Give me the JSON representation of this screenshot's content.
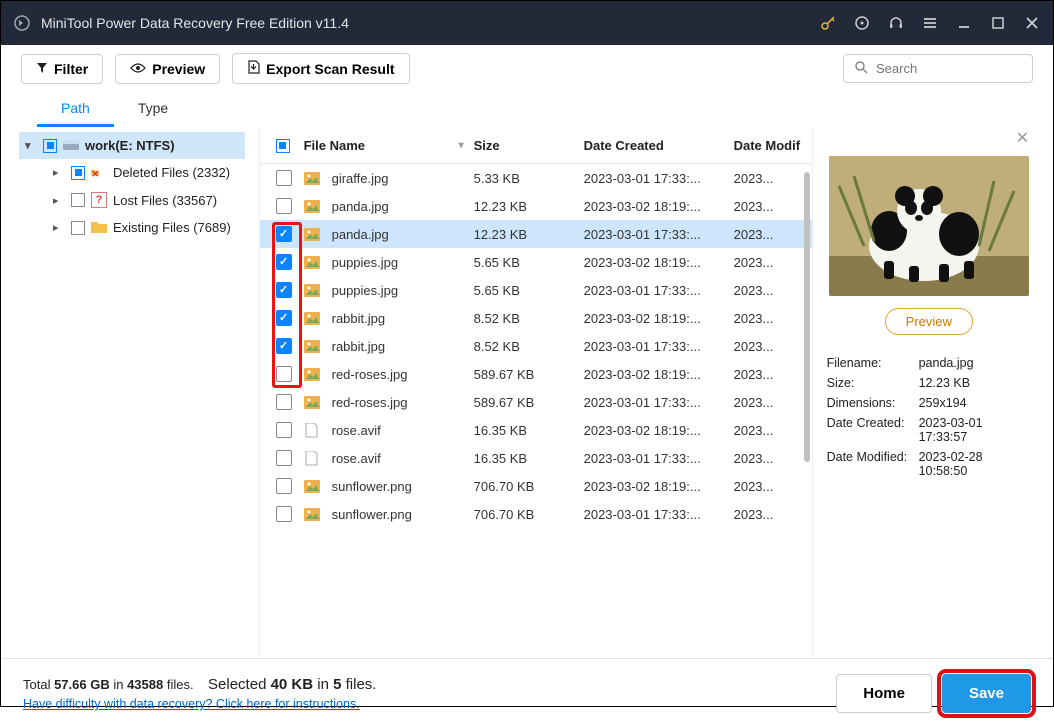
{
  "titlebar": {
    "app_title": "MiniTool Power Data Recovery Free Edition v11.4"
  },
  "toolbar": {
    "filter": "Filter",
    "preview": "Preview",
    "export": "Export Scan Result",
    "search_placeholder": "Search"
  },
  "tabs": {
    "path": "Path",
    "type": "Type"
  },
  "tree": {
    "root": "work(E: NTFS)",
    "children": [
      {
        "label": "Deleted Files (2332)",
        "icon": "deleted"
      },
      {
        "label": "Lost Files (33567)",
        "icon": "lost"
      },
      {
        "label": "Existing Files (7689)",
        "icon": "existing"
      }
    ]
  },
  "columns": {
    "name": "File Name",
    "size": "Size",
    "created": "Date Created",
    "modif": "Date Modif"
  },
  "files": [
    {
      "checked": false,
      "ic": "img",
      "name": "giraffe.jpg",
      "size": "5.33 KB",
      "created": "2023-03-01 17:33:...",
      "modif": "2023...",
      "sel": false
    },
    {
      "checked": false,
      "ic": "img",
      "name": "panda.jpg",
      "size": "12.23 KB",
      "created": "2023-03-02 18:19:...",
      "modif": "2023...",
      "sel": false
    },
    {
      "checked": true,
      "ic": "img",
      "name": "panda.jpg",
      "size": "12.23 KB",
      "created": "2023-03-01 17:33:...",
      "modif": "2023...",
      "sel": true
    },
    {
      "checked": true,
      "ic": "img",
      "name": "puppies.jpg",
      "size": "5.65 KB",
      "created": "2023-03-02 18:19:...",
      "modif": "2023...",
      "sel": false
    },
    {
      "checked": true,
      "ic": "img",
      "name": "puppies.jpg",
      "size": "5.65 KB",
      "created": "2023-03-01 17:33:...",
      "modif": "2023...",
      "sel": false
    },
    {
      "checked": true,
      "ic": "img",
      "name": "rabbit.jpg",
      "size": "8.52 KB",
      "created": "2023-03-02 18:19:...",
      "modif": "2023...",
      "sel": false
    },
    {
      "checked": true,
      "ic": "img",
      "name": "rabbit.jpg",
      "size": "8.52 KB",
      "created": "2023-03-01 17:33:...",
      "modif": "2023...",
      "sel": false
    },
    {
      "checked": false,
      "ic": "img",
      "name": "red-roses.jpg",
      "size": "589.67 KB",
      "created": "2023-03-02 18:19:...",
      "modif": "2023...",
      "sel": false
    },
    {
      "checked": false,
      "ic": "img",
      "name": "red-roses.jpg",
      "size": "589.67 KB",
      "created": "2023-03-01 17:33:...",
      "modif": "2023...",
      "sel": false
    },
    {
      "checked": false,
      "ic": "file",
      "name": "rose.avif",
      "size": "16.35 KB",
      "created": "2023-03-02 18:19:...",
      "modif": "2023...",
      "sel": false
    },
    {
      "checked": false,
      "ic": "file",
      "name": "rose.avif",
      "size": "16.35 KB",
      "created": "2023-03-01 17:33:...",
      "modif": "2023...",
      "sel": false
    },
    {
      "checked": false,
      "ic": "img",
      "name": "sunflower.png",
      "size": "706.70 KB",
      "created": "2023-03-02 18:19:...",
      "modif": "2023...",
      "sel": false
    },
    {
      "checked": false,
      "ic": "img",
      "name": "sunflower.png",
      "size": "706.70 KB",
      "created": "2023-03-01 17:33:...",
      "modif": "2023...",
      "sel": false
    }
  ],
  "preview": {
    "button": "Preview",
    "rows": {
      "filename_l": "Filename:",
      "filename_v": "panda.jpg",
      "size_l": "Size:",
      "size_v": "12.23 KB",
      "dim_l": "Dimensions:",
      "dim_v": "259x194",
      "created_l": "Date Created:",
      "created_v": "2023-03-01 17:33:57",
      "modified_l": "Date Modified:",
      "modified_v": "2023-02-28 10:58:50"
    }
  },
  "footer": {
    "total_pre": "Total ",
    "total_size": "57.66 GB",
    "total_mid": " in ",
    "total_files": "43588",
    "total_suf": " files.",
    "sel_pre": "Selected ",
    "sel_size": "40 KB",
    "sel_mid": " in ",
    "sel_count": "5",
    "sel_suf": " files.",
    "help_link": "Have difficulty with data recovery? Click here for instructions.",
    "home": "Home",
    "save": "Save"
  }
}
